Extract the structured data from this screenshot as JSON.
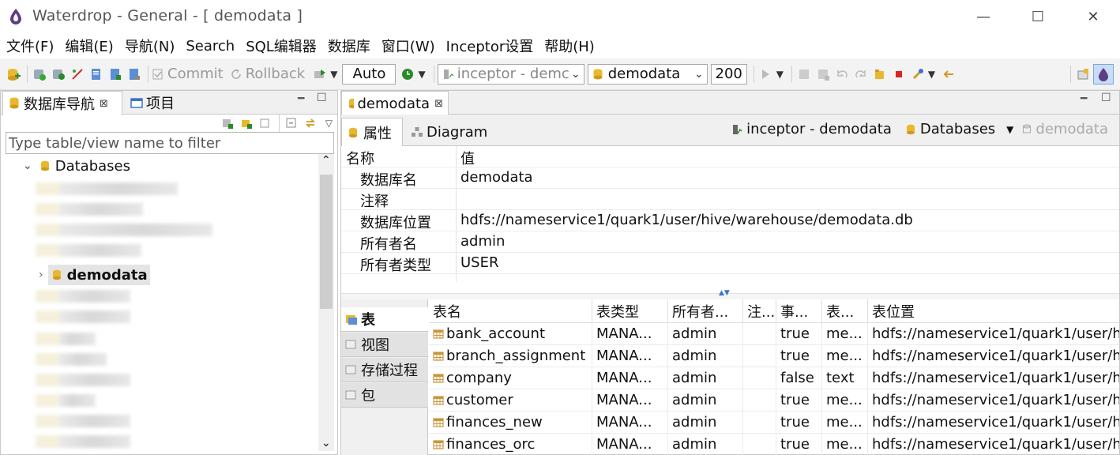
{
  "window": {
    "title": "Waterdrop - General - [ demodata ]",
    "minimize": "—",
    "maximize": "☐",
    "close": "✕"
  },
  "menu": [
    "文件(F)",
    "编辑(E)",
    "导航(N)",
    "Search",
    "SQL编辑器",
    "数据库",
    "窗口(W)",
    "Inceptor设置",
    "帮助(H)"
  ],
  "toolbar": {
    "commit": "Commit",
    "rollback": "Rollback",
    "mode": "Auto",
    "connection": "inceptor - demc",
    "database": "demodata",
    "limit": "200"
  },
  "left": {
    "tab_nav": "数据库导航",
    "tab_project": "项目",
    "filter_placeholder": "Type table/view name to filter",
    "root": "Databases",
    "selected": "demodata"
  },
  "editor": {
    "tab": "demodata",
    "subtab_props": "属性",
    "subtab_diagram": "Diagram",
    "crumb_conn": "inceptor - demodata",
    "crumb_dbs": "Databases",
    "crumb_db": "demodata",
    "prop_header": {
      "name": "名称",
      "value": "值"
    },
    "props": [
      {
        "name": "数据库名",
        "value": "demodata"
      },
      {
        "name": "注释",
        "value": ""
      },
      {
        "name": "数据库位置",
        "value": "hdfs://nameservice1/quark1/user/hive/warehouse/demodata.db"
      },
      {
        "name": "所有者名",
        "value": "admin"
      },
      {
        "name": "所有者类型",
        "value": "USER"
      }
    ],
    "vtabs": [
      "表",
      "视图",
      "存储过程",
      "包"
    ],
    "table": {
      "headers": [
        "表名",
        "表类型",
        "所有者...",
        "注...",
        "事...",
        "表...",
        "表位置"
      ],
      "rows": [
        [
          "bank_account",
          "MANA...",
          "admin",
          "",
          "true",
          "me...",
          "hdfs://nameservice1/quark1/user/hi"
        ],
        [
          "branch_assignment",
          "MANA...",
          "admin",
          "",
          "true",
          "me...",
          "hdfs://nameservice1/quark1/user/hi"
        ],
        [
          "company",
          "MANA...",
          "admin",
          "",
          "false",
          "text",
          "hdfs://nameservice1/quark1/user/hi"
        ],
        [
          "customer",
          "MANA...",
          "admin",
          "",
          "true",
          "me...",
          "hdfs://nameservice1/quark1/user/hi"
        ],
        [
          "finances_new",
          "MANA...",
          "admin",
          "",
          "true",
          "me...",
          "hdfs://nameservice1/quark1/user/hi"
        ],
        [
          "finances_orc",
          "MANA...",
          "admin",
          "",
          "true",
          "me...",
          "hdfs://nameservice1/quark1/user/hi"
        ]
      ]
    }
  },
  "colors": {
    "db_icon": "#e8b830",
    "table_icon": "#c8963c",
    "selected_bg": "#e4e4e4",
    "accent": "#3a74c9"
  }
}
